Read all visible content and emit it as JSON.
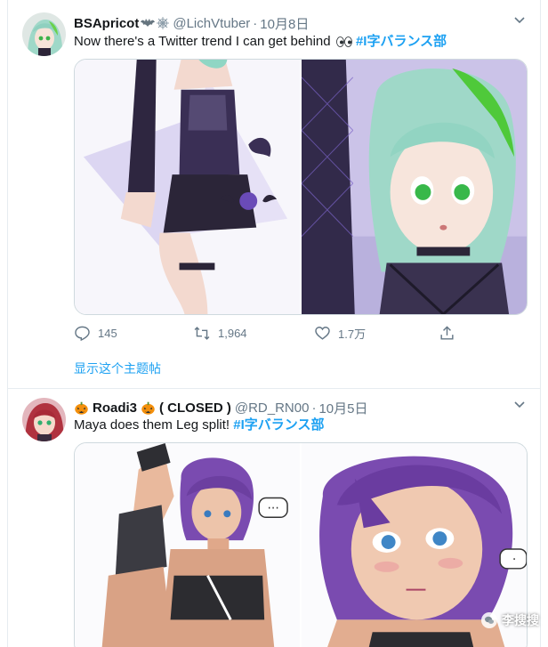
{
  "colors": {
    "link": "#1da1f2",
    "secondary_text": "#657786",
    "border": "#e6ecf0"
  },
  "tweets": [
    {
      "display_name": "BSApricot",
      "name_emojis": [
        "bat-emoji",
        "spider-web-emoji"
      ],
      "handle": "@LichVtuber",
      "separator": "·",
      "date": "10月8日",
      "text": "Now there's a Twitter trend I can get behind",
      "text_emoji": "eyes-emoji",
      "hashtag": "#I字バランス部",
      "media": [
        "anime-girl-split-full-image",
        "anime-girl-closeup-image"
      ],
      "reply_count": "145",
      "retweet_count": "1,964",
      "like_count": "1.7万",
      "show_thread": "显示这个主题帖"
    },
    {
      "display_name_prefix_emoji": "pumpkin-emoji",
      "display_name": "Roadi3",
      "display_name_suffix": "( CLOSED )",
      "handle": "@RD_RN00",
      "separator": "·",
      "date": "10月5日",
      "text": "Maya does them Leg split!",
      "hashtag": "#I字バランス部",
      "media": [
        "purple-hair-girl-split-image",
        "purple-hair-girl-closeup-image"
      ]
    }
  ],
  "watermark": {
    "text": "李搜搜"
  }
}
